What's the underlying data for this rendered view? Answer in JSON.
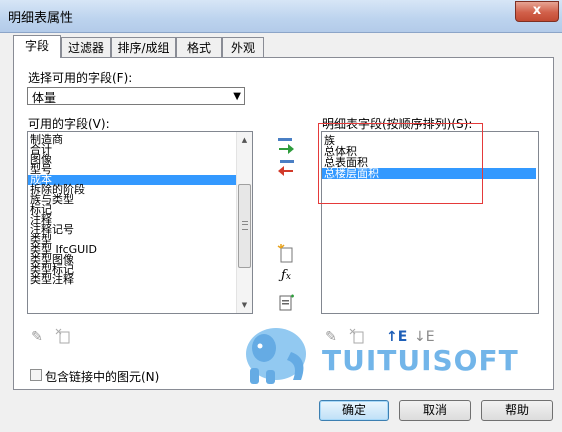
{
  "window": {
    "title": "明细表属性",
    "close_label": "x"
  },
  "tabs": [
    {
      "label": "字段",
      "active": true
    },
    {
      "label": "过滤器",
      "active": false
    },
    {
      "label": "排序/成组",
      "active": false
    },
    {
      "label": "格式",
      "active": false
    },
    {
      "label": "外观",
      "active": false
    }
  ],
  "fields": {
    "select_label": "选择可用的字段(F):",
    "selected_category": "体量",
    "available_label": "可用的字段(V):",
    "available_items": [
      "制造商",
      "合计",
      "图像",
      "型号",
      "成本",
      "拆除的阶段",
      "族与类型",
      "标记",
      "注释",
      "注释记号",
      "类型",
      "类型 IfcGUID",
      "类型图像",
      "类型标记",
      "类型注释"
    ],
    "available_selected_index": 4,
    "schedule_label": "明细表字段(按顺序排列)(S):",
    "schedule_items": [
      "族",
      "总体积",
      "总表面积",
      "总楼层面积"
    ],
    "schedule_selected_index": 3,
    "include_links_label": "包含链接中的图元(N)"
  },
  "buttons": {
    "ok": "确定",
    "cancel": "取消",
    "help": "帮助"
  },
  "watermark": {
    "text": "TUITUISOFT"
  },
  "colors": {
    "selection": "#3399ff",
    "highlight": "#e53a3a",
    "watermark": "#5aa9e6"
  }
}
